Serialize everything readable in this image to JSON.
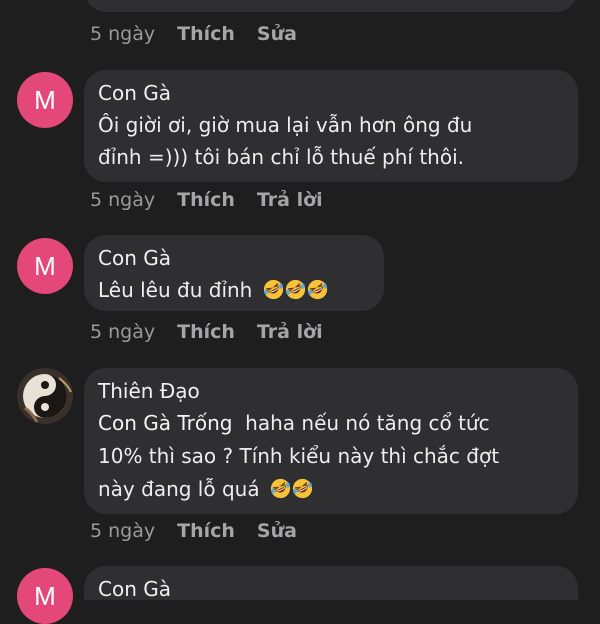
{
  "top_actions": {
    "time": "5 ngày",
    "like": "Thích",
    "edit": "Sửa"
  },
  "comments": [
    {
      "avatar_letter": "M",
      "author": "Con Gà",
      "text_lines": [
        "Ôi giời ơi, giờ mua lại vẫn hơn ông đu",
        "đỉnh =))) tôi bán chỉ lỗ thuế phí thôi."
      ],
      "time": "5 ngày",
      "like": "Thích",
      "reply": "Trả lời"
    },
    {
      "avatar_letter": "M",
      "author": "Con Gà",
      "text": "Lêu lêu đu đỉnh",
      "emoji": "rofl-emoji",
      "time": "5 ngày",
      "like": "Thích",
      "reply": "Trả lời"
    },
    {
      "author": "Thiên Đạo",
      "mention": "Con Gà Trống",
      "text_line1": "  haha nếu nó tăng cổ tức",
      "text_line2": "10% thì sao ? Tính kiểu này thì chắc đợt",
      "text_line3": "này đang lỗ quá",
      "time": "5 ngày",
      "like": "Thích",
      "edit": "Sửa"
    },
    {
      "avatar_letter": "M",
      "author": "Con Gà"
    }
  ],
  "colors": {
    "background": "#1e1e1f",
    "bubble": "#2f2f31",
    "avatar_pink": "#e4477a",
    "meta_text": "#9a9a9c"
  }
}
